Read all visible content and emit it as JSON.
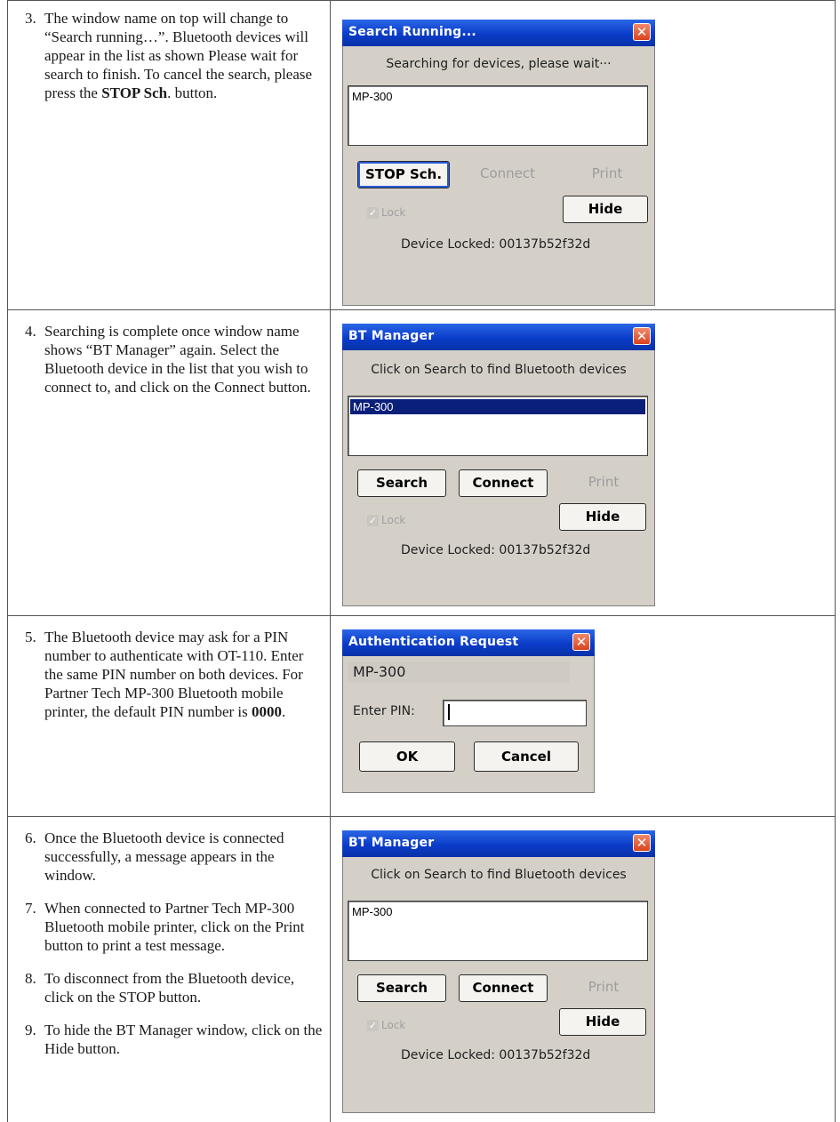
{
  "steps": [
    {
      "num": "3.",
      "text_before": "The window name on top will change to “Search running…”. Bluetooth devices will appear in the list as shown Please wait for search to finish. To cancel the search, please press the ",
      "bold": "STOP Sch",
      "text_after": ". button."
    },
    {
      "num": "4.",
      "text": "Searching is complete once window name shows “BT Manager” again. Select the Bluetooth device in the list that you wish to connect to, and click on the Connect button."
    },
    {
      "num": "5.",
      "text_before": "The Bluetooth device may ask for a PIN number to authenticate with OT-110. Enter the same PIN number on both devices. For Partner Tech MP-300 Bluetooth mobile printer, the default PIN number is ",
      "bold": "0000",
      "text_after": "."
    },
    {
      "num": "6.",
      "text": "Once the Bluetooth device is connected successfully, a message appears in the window."
    },
    {
      "num": "7.",
      "text": "When connected to Partner Tech MP-300 Bluetooth mobile printer, click on the Print button to print a test message."
    },
    {
      "num": "8.",
      "text": "To disconnect from the Bluetooth device, click on the STOP button."
    },
    {
      "num": "9.",
      "text": "To hide the BT Manager window, click on the Hide button."
    }
  ],
  "dialogs": {
    "search_running": {
      "title": "Search Running...",
      "message": "Searching for devices, please wait···",
      "list_item": "MP-300",
      "stop_label": "STOP Sch.",
      "connect_label": "Connect",
      "print_label": "Print",
      "hide_label": "Hide",
      "lock_label": "Lock",
      "locked_text": "Device Locked: 00137b52f32d"
    },
    "bt_manager_selected": {
      "title": "BT Manager",
      "message": "Click on Search to find Bluetooth devices",
      "list_item": "MP-300",
      "search_label": "Search",
      "connect_label": "Connect",
      "print_label": "Print",
      "hide_label": "Hide",
      "lock_label": "Lock",
      "locked_text": "Device Locked: 00137b52f32d"
    },
    "auth_request": {
      "title": "Authentication Request",
      "device": "MP-300",
      "pin_label": "Enter PIN:",
      "pin_value": "",
      "ok_label": "OK",
      "cancel_label": "Cancel"
    },
    "bt_manager_connected": {
      "title": "BT Manager",
      "message": "Click on Search to find Bluetooth devices",
      "list_item": "MP-300",
      "search_label": "Search",
      "connect_label": "Connect",
      "print_label": "Print",
      "hide_label": "Hide",
      "lock_label": "Lock",
      "locked_text": "Device Locked: 00137b52f32d"
    }
  },
  "icons": {
    "close": "close-icon",
    "check": "check-icon"
  },
  "colors": {
    "titlebar": "#0a3cc8",
    "dialog_bg": "#d4d0c8",
    "selection": "#0a1f7a",
    "close": "#d9421d"
  }
}
